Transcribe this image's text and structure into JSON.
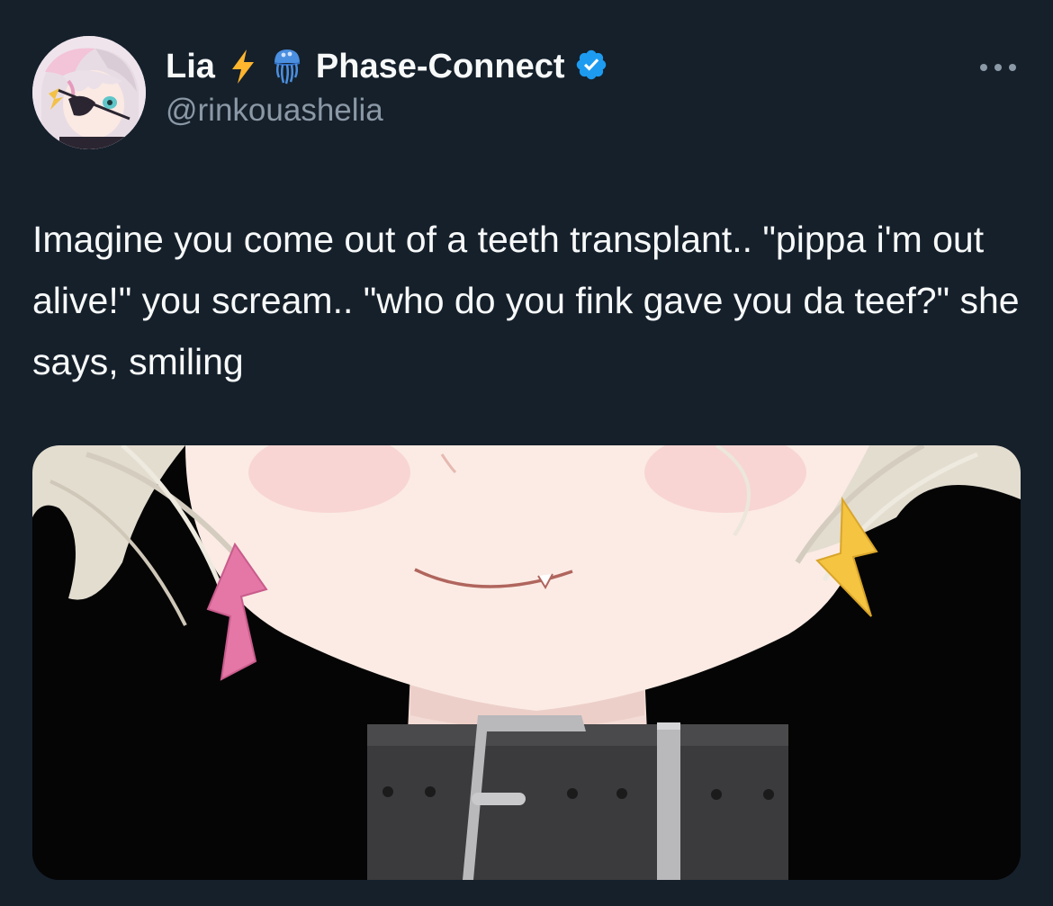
{
  "author": {
    "display_name": "Lia",
    "name_emojis": [
      "lightning-emoji",
      "jellyfish-emoji"
    ],
    "name_suffix": "Phase-Connect",
    "handle": "@rinkouashelia",
    "verified": true,
    "verified_color": "#1d9bf0"
  },
  "tweet": {
    "text": "Imagine you come out of a teeth transplant.. \"pippa i'm out alive!\" you scream.. \"who do you fink gave you da teef?\" she says, smiling"
  },
  "media": {
    "kind": "anime-illustration",
    "depicts": [
      "smiling-face",
      "pink-lightning-earring",
      "yellow-lightning-earring",
      "black-collar-with-buckle"
    ]
  },
  "icons": {
    "more": "more-icon",
    "verified": "verified-badge-icon"
  },
  "colors": {
    "background": "#15202b",
    "text_primary": "#f7f9f9",
    "text_secondary": "#8b98a5",
    "accent": "#1d9bf0"
  }
}
